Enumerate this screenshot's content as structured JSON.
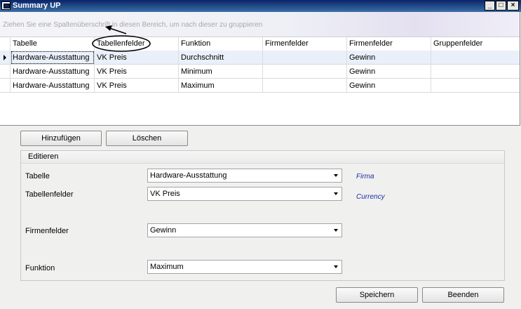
{
  "window": {
    "title": "Summary UP",
    "controls": {
      "minimize": "_",
      "maximize": "□",
      "close": "×"
    }
  },
  "grid": {
    "group_hint": "Ziehen Sie eine Spaltenüberschrift in diesen Bereich, um nach dieser zu gruppieren",
    "columns": [
      "Tabelle",
      "Tabellenfelder",
      "Funktion",
      "Firmenfelder",
      "Firmenfelder",
      "Gruppenfelder"
    ],
    "rows": [
      {
        "cells": [
          "Hardware-Ausstattung",
          "VK Preis",
          "Durchschnitt",
          "",
          "Gewinn",
          ""
        ],
        "selected": true
      },
      {
        "cells": [
          "Hardware-Ausstattung",
          "VK Preis",
          "Minimum",
          "",
          "Gewinn",
          ""
        ],
        "selected": false
      },
      {
        "cells": [
          "Hardware-Ausstattung",
          "VK Preis",
          "Maximum",
          "",
          "Gewinn",
          ""
        ],
        "selected": false
      }
    ]
  },
  "actions": {
    "add": "Hinzufügen",
    "delete": "Löschen"
  },
  "edit": {
    "legend": "Editieren",
    "table_label": "Tabelle",
    "table_value": "Hardware-Ausstattung",
    "table_hint": "Firma",
    "fields_label": "Tabellenfelder",
    "fields_value": "VK Preis",
    "fields_hint": "Currency",
    "company_label": "Firmenfelder",
    "company_value": "Gewinn",
    "function_label": "Funktion",
    "function_value": "Maximum"
  },
  "footer": {
    "save": "Speichern",
    "quit": "Beenden"
  },
  "colors": {
    "titlebar": "#0a246a",
    "hint_text": "#1f2fa8",
    "selected_row": "#eaf0fa"
  },
  "icons": [
    "app-icon",
    "row-pointer-icon",
    "dropdown-arrow-icon",
    "annotation-arrow-icon"
  ]
}
